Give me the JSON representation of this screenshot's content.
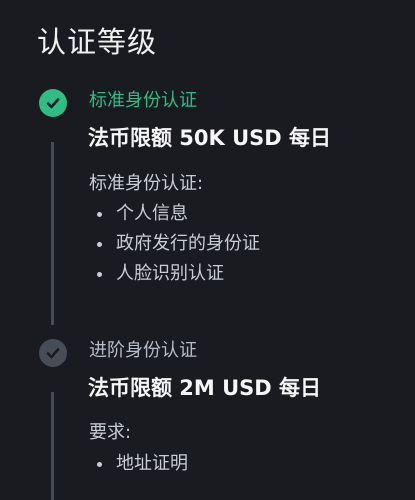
{
  "page": {
    "title": "认证等级"
  },
  "colors": {
    "background": "#1a1b21",
    "accent_green": "#2ebd85",
    "inactive_gray": "#474d57",
    "text_primary": "#f5f5f5",
    "text_secondary": "#c9cdd4"
  },
  "levels": [
    {
      "status": "completed",
      "icon": "check-circle-filled-green-icon",
      "name": "标准身份认证",
      "limit": "法币限额 50K USD 每日",
      "requirements_title": "标准身份认证:",
      "requirements": [
        "个人信息",
        "政府发行的身份证",
        "人脸识别认证"
      ]
    },
    {
      "status": "pending",
      "icon": "check-circle-filled-gray-icon",
      "name": "进阶身份认证",
      "limit": "法币限额 2M USD 每日",
      "requirements_title": "要求:",
      "requirements": [
        "地址证明"
      ]
    }
  ]
}
